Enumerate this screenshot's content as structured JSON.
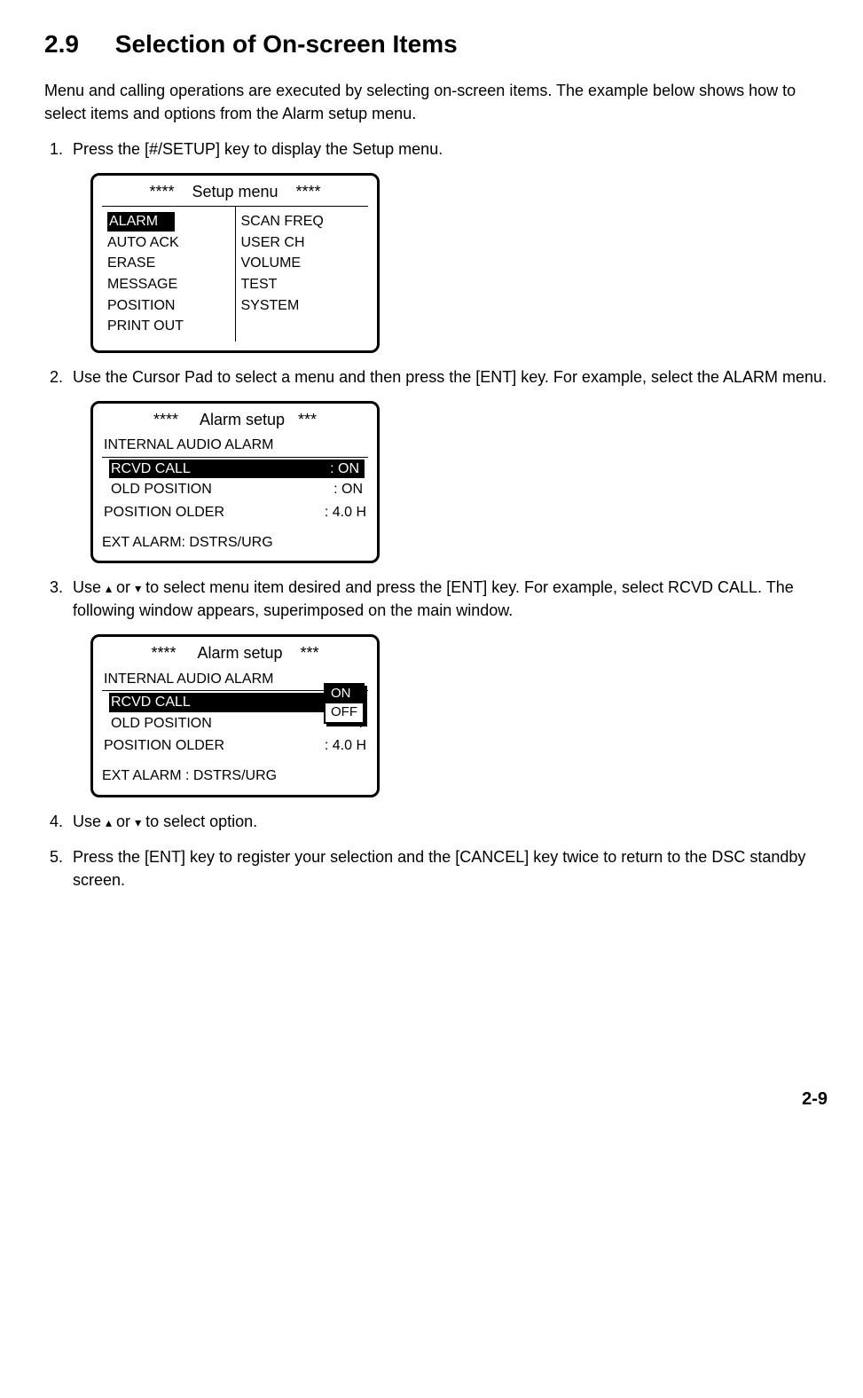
{
  "section": {
    "number": "2.9",
    "title": "Selection of On-screen Items"
  },
  "intro": "Menu and calling operations are executed by selecting on-screen items. The example below shows how to select items and options from the Alarm setup menu.",
  "steps": {
    "s1": "Press the [#/SETUP] key to display the Setup menu.",
    "s2": "Use the Cursor Pad to select a menu and then press the [ENT] key. For example, select the ALARM menu.",
    "s3_a": "Use ",
    "s3_b": " or ",
    "s3_c": " to select menu item desired and press the [ENT] key. For example, select RCVD CALL. The following window appears, superimposed on the main window.",
    "s4_a": "Use ",
    "s4_b": " or ",
    "s4_c": " to select option.",
    "s5": "Press the [ENT] key to register your selection and the [CANCEL] key twice to return to the DSC standby screen."
  },
  "arrows": {
    "up": "▴",
    "down": "▾"
  },
  "screen1": {
    "title": "****    Setup menu    ****",
    "left": [
      "ALARM",
      "AUTO  ACK",
      "ERASE",
      "MESSAGE",
      "POSITION",
      "PRINT OUT"
    ],
    "right": [
      "SCAN  FREQ",
      "USER  CH",
      "VOLUME",
      "",
      "TEST",
      "SYSTEM"
    ]
  },
  "screen2": {
    "title": "****     Alarm setup   ***",
    "header": "INTERNAL AUDIO ALARM",
    "rows": [
      {
        "label": "RCVD CALL",
        "value": ": ON",
        "selected": true
      },
      {
        "label": "OLD POSITION",
        "value": ": ON",
        "selected": false
      }
    ],
    "pos_older_label": "POSITION OLDER",
    "pos_older_value": ": 4.0 H",
    "ext": "EXT ALARM: DSTRS/URG"
  },
  "screen3": {
    "title": "****     Alarm setup    ***",
    "header": "INTERNAL AUDIO ALARM",
    "rows": [
      {
        "label": "RCVD CALL",
        "value": ":",
        "selected": true
      },
      {
        "label": "OLD POSITION",
        "value": ":",
        "selected": false
      }
    ],
    "pos_older_label": "POSITION OLDER",
    "pos_older_value": ": 4.0 H",
    "ext": "EXT ALARM : DSTRS/URG",
    "popup": {
      "on": "ON",
      "off": "OFF"
    }
  },
  "pagenum": "2-9"
}
